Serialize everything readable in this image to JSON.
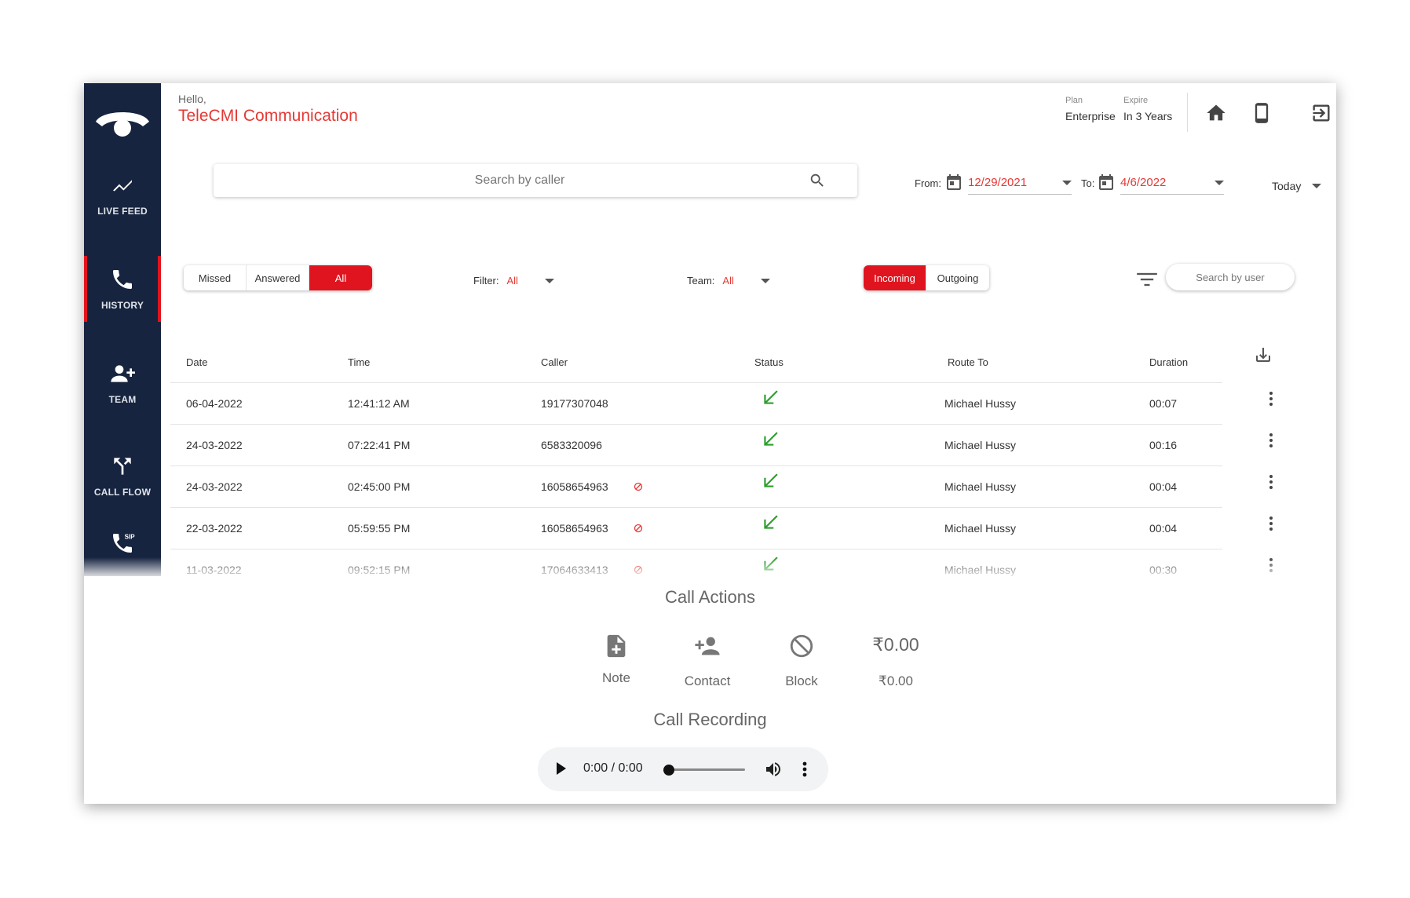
{
  "header": {
    "greeting": "Hello,",
    "company": "TeleCMI Communication",
    "plan_label": "Plan",
    "plan_value": "Enterprise",
    "expire_label": "Expire",
    "expire_value": "In 3 Years"
  },
  "sidebar": {
    "items": [
      {
        "label": "LIVE FEED",
        "icon": "trending-line-icon"
      },
      {
        "label": "HISTORY",
        "icon": "phone-icon"
      },
      {
        "label": "TEAM",
        "icon": "add-user-icon"
      },
      {
        "label": "CALL FLOW",
        "icon": "call-split-icon"
      },
      {
        "label": "",
        "icon": "sip-phone-icon"
      }
    ]
  },
  "search": {
    "placeholder": "Search by caller"
  },
  "dates": {
    "from_label": "From:",
    "from_value": "12/29/2021",
    "to_label": "To:",
    "to_value": "4/6/2022",
    "range": "Today"
  },
  "call_type": {
    "options": [
      "Missed",
      "Answered",
      "All"
    ],
    "selected": "All"
  },
  "filter": {
    "label": "Filter:",
    "value": "All"
  },
  "team": {
    "label": "Team:",
    "value": "All"
  },
  "direction": {
    "options": [
      "Incoming",
      "Outgoing"
    ],
    "selected": "Incoming"
  },
  "user_search": {
    "placeholder": "Search by user"
  },
  "table": {
    "columns": [
      "Date",
      "Time",
      "Caller",
      "Status",
      "Route To",
      "Duration"
    ],
    "rows": [
      {
        "date": "06-04-2022",
        "time": "12:41:12 AM",
        "caller": "19177307048",
        "blocked": false,
        "status": "incoming",
        "route": "Michael Hussy",
        "duration": "00:07"
      },
      {
        "date": "24-03-2022",
        "time": "07:22:41 PM",
        "caller": "6583320096",
        "blocked": false,
        "status": "incoming",
        "route": "Michael Hussy",
        "duration": "00:16"
      },
      {
        "date": "24-03-2022",
        "time": "02:45:00 PM",
        "caller": "16058654963",
        "blocked": true,
        "status": "incoming",
        "route": "Michael Hussy",
        "duration": "00:04"
      },
      {
        "date": "22-03-2022",
        "time": "05:59:55 PM",
        "caller": "16058654963",
        "blocked": true,
        "status": "incoming",
        "route": "Michael Hussy",
        "duration": "00:04"
      },
      {
        "date": "11-03-2022",
        "time": "09:52:15 PM",
        "caller": "17064633413",
        "blocked": true,
        "status": "incoming",
        "route": "Michael Hussy",
        "duration": "00:30"
      }
    ]
  },
  "call_actions": {
    "title": "Call Actions",
    "note": "Note",
    "contact": "Contact",
    "block": "Block",
    "cost_value": "₹0.00",
    "cost_label": "₹0.00"
  },
  "recording": {
    "title": "Call Recording",
    "time": "0:00 / 0:00"
  },
  "colors": {
    "accent": "#e0141e",
    "sidebar": "#17243f",
    "status_green": "#2e9d2e"
  }
}
